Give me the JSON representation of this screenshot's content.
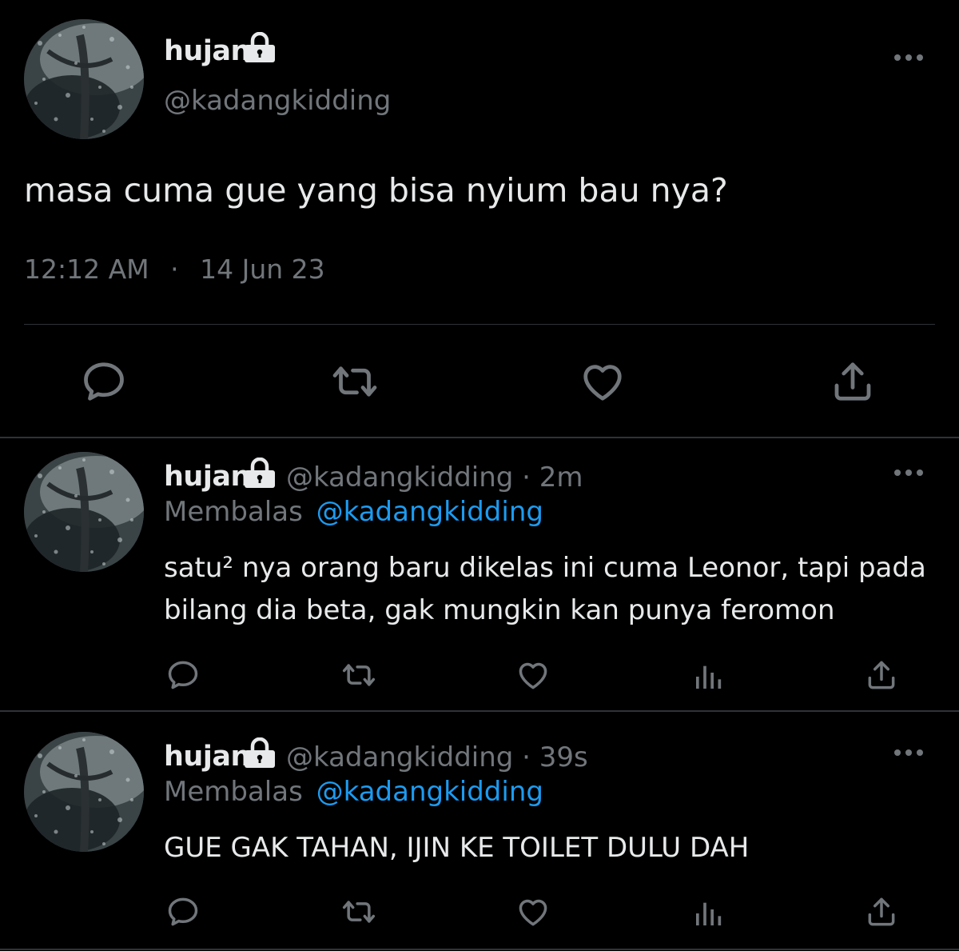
{
  "main_tweet": {
    "name": "hujan",
    "handle": "@kadangkidding",
    "text": "masa cuma gue yang bisa nyium bau nya?",
    "time": "12:12 AM",
    "separator": "·",
    "date": "14 Jun 23"
  },
  "replies": [
    {
      "name": "hujan",
      "handle_time": "@kadangkidding · 2m",
      "reply_prefix": "Membalas",
      "reply_to": "@kadangkidding",
      "text_line1": "satu² nya orang baru dikelas ini cuma Leonor, tapi pada",
      "text_line2": "bilang dia beta, gak mungkin kan punya feromon"
    },
    {
      "name": "hujan",
      "handle_time": "@kadangkidding · 39s",
      "reply_prefix": "Membalas",
      "reply_to": "@kadangkidding",
      "text_line1": "GUE GAK TAHAN, IJIN KE TOILET DULU DAH"
    }
  ],
  "icons": {
    "avatar": "rain-window-avatar",
    "lock": "lock-icon",
    "more": "more-options-icon",
    "reply": "reply-icon",
    "retweet": "retweet-icon",
    "like": "heart-icon",
    "views": "analytics-icon",
    "share": "share-icon"
  },
  "colors": {
    "background": "#000000",
    "text": "#e7e9ea",
    "secondary": "#71767b",
    "link": "#1d9bf0",
    "divider": "#2f3336"
  }
}
